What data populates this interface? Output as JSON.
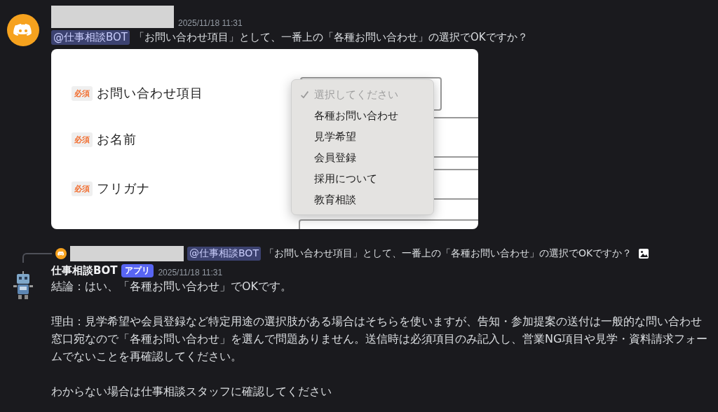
{
  "message": {
    "timestamp": "2025/11/18 11:31",
    "mention": "@仕事相談BOT",
    "text": "「お問い合わせ項目」として、一番上の「各種お問い合わせ」の選択でOKですか？",
    "attachment": {
      "fields": [
        {
          "badge": "必須",
          "label": "お問い合わせ項目"
        },
        {
          "badge": "必須",
          "label": "お名前"
        },
        {
          "badge": "必須",
          "label": "フリガナ"
        }
      ],
      "options": [
        {
          "label": "選択してください",
          "selected": true
        },
        {
          "label": "各種お問い合わせ",
          "selected": false
        },
        {
          "label": "見学希望",
          "selected": false
        },
        {
          "label": "会員登録",
          "selected": false
        },
        {
          "label": "採用について",
          "selected": false
        },
        {
          "label": "教育相談",
          "selected": false
        }
      ]
    }
  },
  "reply": {
    "reference": {
      "mention": "@仕事相談BOT",
      "text": "「お問い合わせ項目」として、一番上の「各種お問い合わせ」の選択でOKですか？"
    },
    "author": "仕事相談BOT",
    "tag": "アプリ",
    "timestamp": "2025/11/18 11:31",
    "paragraphs": [
      "結論：はい、「各種お問い合わせ」でOKです。",
      "理由：見学希望や会員登録など特定用途の選択肢がある場合はそちらを使いますが、告知・参加提案の送付は一般的な問い合わせ窓口宛なので「各種お問い合わせ」を選んで問題ありません。送信時は必須項目のみ記入し、営業NG項目や見学・資料請求フォームでないことを再確認してください。",
      "わからない場合は仕事相談スタッフに確認してください"
    ]
  }
}
